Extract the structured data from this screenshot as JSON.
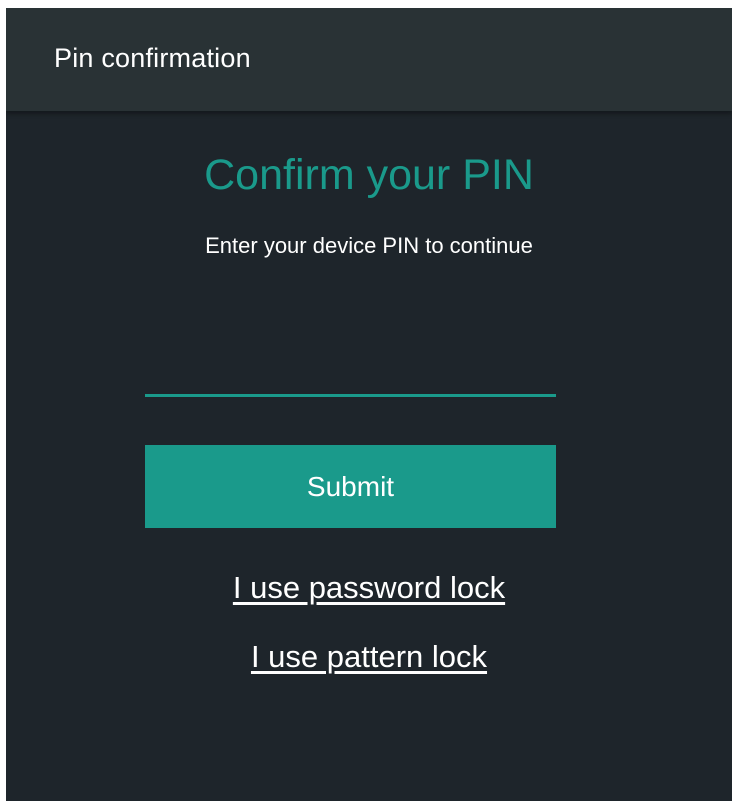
{
  "titlebar": {
    "title": "Pin confirmation"
  },
  "main": {
    "heading": "Confirm your PIN",
    "subheading": "Enter your device PIN to continue",
    "pin_input": {
      "value": "",
      "placeholder": ""
    },
    "submit_label": "Submit",
    "links": {
      "password_lock": "I use password lock",
      "pattern_lock": "I use pattern lock"
    }
  },
  "colors": {
    "background": "#1e252b",
    "titlebar": "#293235",
    "accent": "#1a9a8b",
    "text": "#ffffff"
  }
}
